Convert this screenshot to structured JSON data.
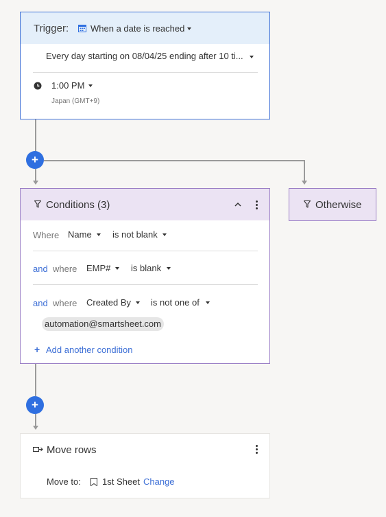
{
  "trigger": {
    "label": "Trigger:",
    "type_label": "When a date is reached",
    "schedule": "Every day starting on 08/04/25 ending after 10 ti...",
    "time": "1:00 PM",
    "timezone": "Japan (GMT+9)"
  },
  "conditions": {
    "title": "Conditions (3)",
    "rows": [
      {
        "prefix": "",
        "where": "Where",
        "field": "Name",
        "operator": "is not blank"
      },
      {
        "prefix": "and",
        "where": "where",
        "field": "EMP#",
        "operator": "is blank"
      },
      {
        "prefix": "and",
        "where": "where",
        "field": "Created By",
        "operator": "is not one of",
        "value": "automation@smartsheet.com"
      }
    ],
    "add_label": "Add another condition"
  },
  "otherwise": {
    "label": "Otherwise"
  },
  "action": {
    "title": "Move rows",
    "move_to_label": "Move to:",
    "sheet_name": "1st Sheet",
    "change_label": "Change"
  },
  "colors": {
    "accent": "#2f6fe0",
    "trigger_border": "#3d6fd6",
    "trigger_header": "#e4effa",
    "condition_border": "#9b7fc6",
    "condition_header": "#ebe3f3",
    "connector": "#9a9a9a"
  }
}
